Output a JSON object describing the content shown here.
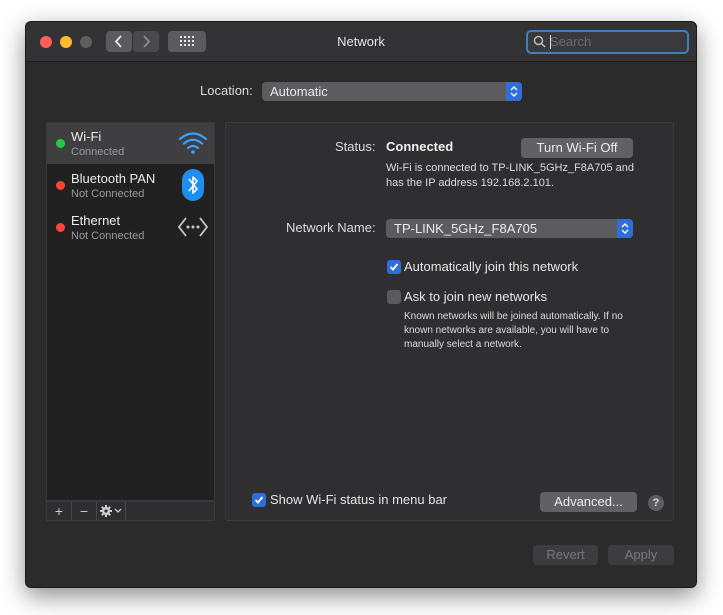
{
  "window": {
    "title": "Network"
  },
  "search": {
    "placeholder": "Search"
  },
  "location": {
    "label": "Location:",
    "value": "Automatic"
  },
  "services": [
    {
      "name": "Wi-Fi",
      "status": "Connected",
      "dot_color": "#28c840",
      "icon": "wifi-icon",
      "selected": true
    },
    {
      "name": "Bluetooth PAN",
      "status": "Not Connected",
      "dot_color": "#ff453a",
      "icon": "bluetooth-icon",
      "selected": false
    },
    {
      "name": "Ethernet",
      "status": "Not Connected",
      "dot_color": "#ff453a",
      "icon": "ethernet-icon",
      "selected": false
    }
  ],
  "sidebar_toolbar": {
    "add": "+",
    "remove": "−"
  },
  "detail": {
    "status_label": "Status:",
    "status_value": "Connected",
    "turn_off_button": "Turn Wi-Fi Off",
    "status_description": "Wi-Fi is connected to TP-LINK_5GHz_F8A705 and has the IP address 192.168.2.101.",
    "network_name_label": "Network Name:",
    "network_name_value": "TP-LINK_5GHz_F8A705",
    "auto_join_label": "Automatically join this network",
    "auto_join_checked": true,
    "ask_join_label": "Ask to join new networks",
    "ask_join_checked": false,
    "ask_join_hint": "Known networks will be joined automatically. If no known networks are available, you will have to manually select a network.",
    "show_status_label": "Show Wi-Fi status in menu bar",
    "show_status_checked": true,
    "advanced_button": "Advanced...",
    "help_button": "?"
  },
  "footer": {
    "revert_button": "Revert",
    "apply_button": "Apply"
  },
  "colors": {
    "accent": "#2f6ed8",
    "wifi_icon": "#3ba0ff",
    "bluetooth_badge": "#1e8ef0"
  }
}
